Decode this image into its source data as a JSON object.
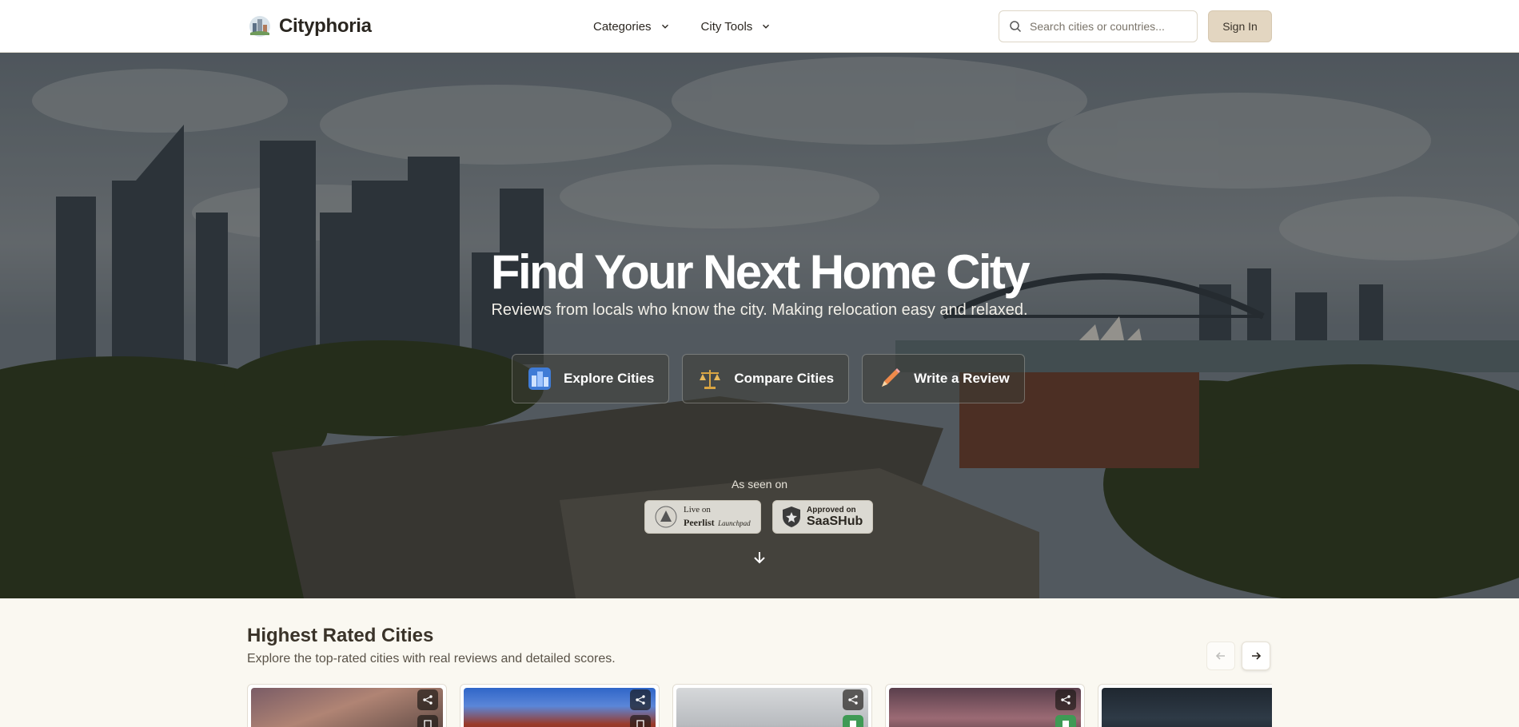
{
  "header": {
    "brand": "Cityphoria",
    "nav": [
      {
        "label": "Categories"
      },
      {
        "label": "City Tools"
      }
    ],
    "search_placeholder": "Search cities or countries...",
    "signin_label": "Sign In"
  },
  "hero": {
    "title": "Find Your Next Home City",
    "subtitle": "Reviews from locals who know the city. Making relocation easy and relaxed.",
    "actions": [
      {
        "label": "Explore Cities",
        "icon": "city-icon"
      },
      {
        "label": "Compare Cities",
        "icon": "scales-icon"
      },
      {
        "label": "Write a Review",
        "icon": "pencil-icon"
      }
    ],
    "seen_on": "As seen on",
    "badges": {
      "peerlist": {
        "line1": "Live on",
        "line2": "Peerlist",
        "line3": "Launchpad"
      },
      "saashub": {
        "line1": "Approved on",
        "line2": "SaaSHub"
      }
    }
  },
  "section": {
    "title": "Highest Rated Cities",
    "subtitle": "Explore the top-rated cities with real reviews and detailed scores."
  },
  "colors": {
    "accent": "#e3d6c1",
    "save_active": "#3f9a55",
    "page_background": "#faf8f1"
  }
}
